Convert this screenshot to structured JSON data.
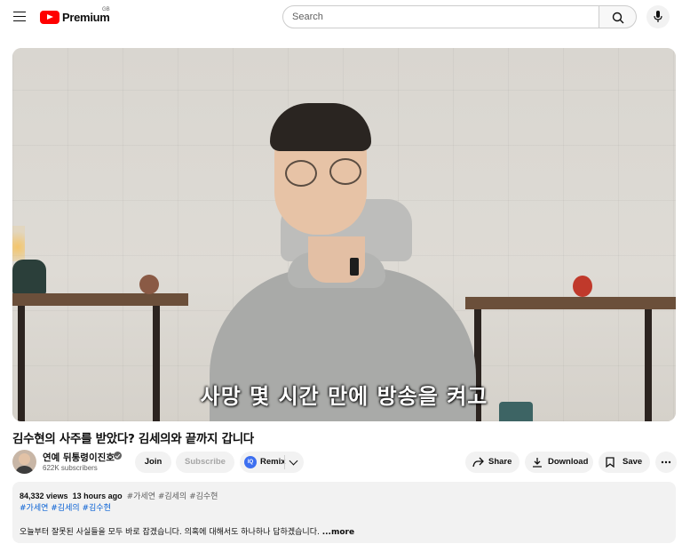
{
  "header": {
    "logo_text": "Premium",
    "country_code": "GB",
    "search_placeholder": "Search"
  },
  "video": {
    "caption": "사망 몇 시간 만에 방송을 켜고",
    "title": "김수현의 사주를 받았다? 김세의와 끝까지 갑니다"
  },
  "channel": {
    "name": "연예 뒤통령이진호",
    "subscribers": "622K subscribers"
  },
  "actions": {
    "join": "Join",
    "subscribe": "Subscribe",
    "remix": "Remix",
    "share": "Share",
    "download": "Download",
    "save": "Save"
  },
  "description": {
    "views": "84,332 views",
    "time": "13 hours ago",
    "inline_tags": "#가세연 #김세의 #김수현",
    "hashtags": "#가세연 #김세의 #김수현",
    "text": "오늘부터 잘못된 사실들을 모두 바로 잡겠습니다. 의혹에 대해서도 하나하나 답하겠습니다.",
    "more": "...more"
  },
  "icons": {
    "menu": "hamburger-menu-icon",
    "search": "search-icon",
    "mic": "microphone-icon",
    "verified": "verified-check-icon",
    "share": "share-arrow-icon",
    "download": "download-icon",
    "save": "bookmark-icon",
    "more": "more-horizontal-icon"
  },
  "colors": {
    "brand_red": "#ff0000",
    "link_blue": "#065fd4",
    "pill_bg": "#f2f2f2"
  }
}
